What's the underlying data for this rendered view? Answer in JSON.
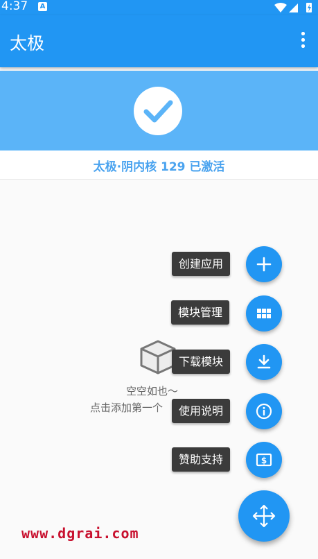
{
  "status_bar": {
    "time": "4:37",
    "notification_badge": "A"
  },
  "app_bar": {
    "title": "太极",
    "menu_icon": "more-vert-icon"
  },
  "hero": {
    "icon": "check-icon",
    "status_text": "太极·阴内核 129 已激活"
  },
  "empty_state": {
    "icon": "package-box-icon",
    "line1": "空空如也～",
    "line2": "点击添加第一个"
  },
  "fab_menu": [
    {
      "label": "创建应用",
      "icon": "plus-icon"
    },
    {
      "label": "模块管理",
      "icon": "grid-icon"
    },
    {
      "label": "下载模块",
      "icon": "download-icon"
    },
    {
      "label": "使用说明",
      "icon": "info-icon"
    },
    {
      "label": "赞助支持",
      "icon": "money-icon"
    }
  ],
  "fab_main_icon": "move-arrows-icon",
  "watermark": "www.dgrai.com",
  "colors": {
    "primary": "#2196f3",
    "hero": "#5bb4f8",
    "status_text": "#4aa3ef",
    "watermark": "#c8102e"
  }
}
